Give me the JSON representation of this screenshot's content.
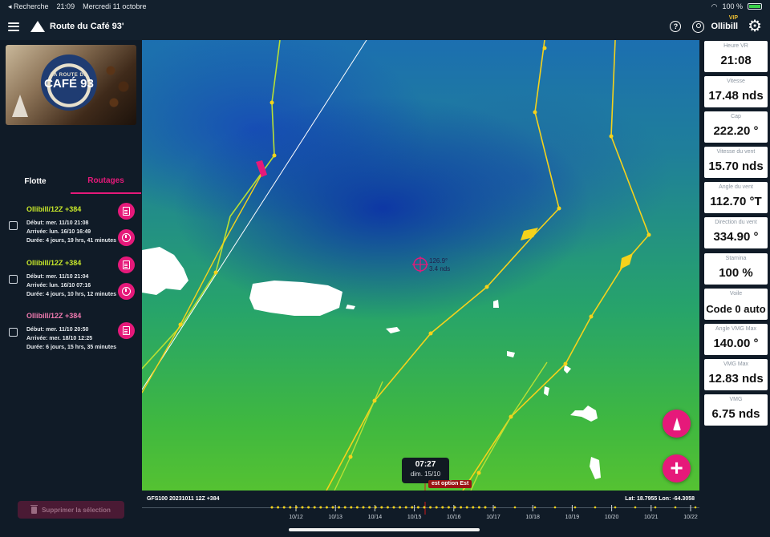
{
  "statusbar": {
    "back": "◂ Recherche",
    "time": "21:09",
    "date": "Mercredi 11 octobre",
    "battery": "100 %"
  },
  "header": {
    "title": "Route du Café 93'",
    "help": "?",
    "username": "Ollibill",
    "badge": "VIP"
  },
  "banner": {
    "top": "LA ROUTE DU",
    "main": "CAFÉ 93"
  },
  "tabs": [
    {
      "label": "Flotte"
    },
    {
      "label": "Routages"
    }
  ],
  "routes": [
    {
      "name": "Ollibill/12Z +384",
      "color": "#c8e82a",
      "start": "Début: mer. 11/10 21:08",
      "arrival": "Arrivée: lun. 16/10 16:49",
      "duration": "Durée: 4 jours, 19 hrs, 41 minutes"
    },
    {
      "name": "Ollibill/12Z +384",
      "color": "#c8e82a",
      "start": "Début: mer. 11/10 21:04",
      "arrival": "Arrivée: lun. 16/10 07:16",
      "duration": "Durée: 4 jours, 10 hrs, 12 minutes"
    },
    {
      "name": "Ollibill/12Z +384",
      "color": "#f07ab0",
      "start": "Début: mer. 11/10 20:50",
      "arrival": "Arrivée: mer. 18/10 12:25",
      "duration": "Durée: 6 jours, 15 hrs, 35 minutes"
    }
  ],
  "delete_label": "Supprimer la sélection",
  "map": {
    "cursor_heading": "126.9°",
    "cursor_speed": "3.4 nds",
    "bubble_time": "07:27",
    "bubble_date": "dim. 15/10",
    "option_label": "est option Est"
  },
  "stats": [
    {
      "label": "Heure VR",
      "value": "21:08"
    },
    {
      "label": "Vitesse",
      "value": "17.48 nds"
    },
    {
      "label": "Cap",
      "value": "222.20 °"
    },
    {
      "label": "Vitesse du vent",
      "value": "15.70 nds"
    },
    {
      "label": "Angle du vent",
      "value": "112.70 °T"
    },
    {
      "label": "Direction du vent",
      "value": "334.90 °"
    },
    {
      "label": "Stamina",
      "value": "100 %"
    },
    {
      "label": "Voile",
      "value": "Code 0 auto"
    },
    {
      "label": "Angle VMG Max",
      "value": "140.00 °"
    },
    {
      "label": "VMG Max",
      "value": "12.83 nds"
    },
    {
      "label": "VMG",
      "value": "6.75 nds"
    }
  ],
  "timeline": {
    "model": "GFS100 20231011 12Z +384",
    "coords": "Lat: 18.7955 Lon: -64.3058",
    "ticks": [
      "10/12",
      "10/13",
      "10/14",
      "10/15",
      "10/16",
      "10/17",
      "10/18",
      "10/19",
      "10/20",
      "10/21",
      "10/22"
    ]
  },
  "colors": {
    "accent": "#e6197a",
    "route_yellow": "#f5d21b",
    "route_green": "#c8e82a"
  }
}
